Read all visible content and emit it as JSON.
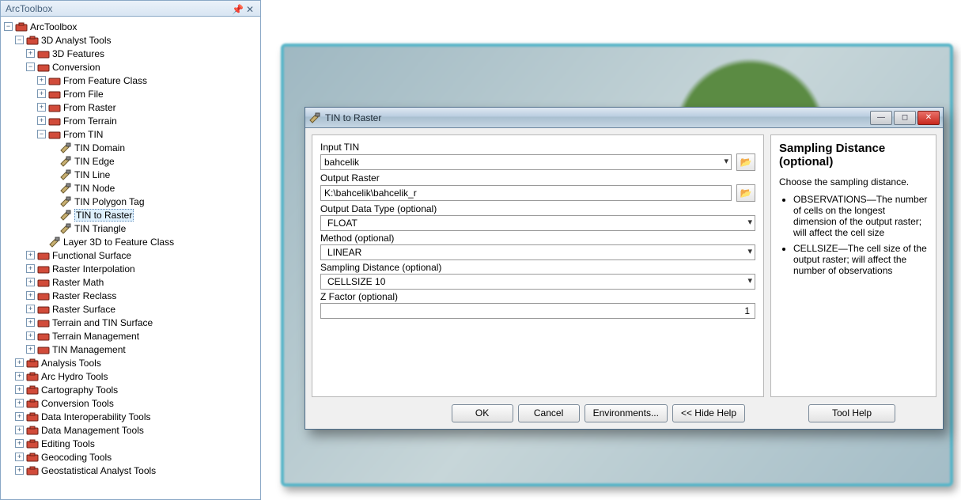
{
  "panel": {
    "title": "ArcToolbox"
  },
  "tree": {
    "root": "ArcToolbox",
    "n3d": "3D Analyst Tools",
    "n3d_feat": "3D Features",
    "conv": "Conversion",
    "ffc": "From Feature Class",
    "ffile": "From File",
    "fraster": "From Raster",
    "fterrain": "From Terrain",
    "ftin": "From TIN",
    "tindomain": "TIN Domain",
    "tinedge": "TIN Edge",
    "tinline": "TIN Line",
    "tinnode": "TIN Node",
    "tinpoly": "TIN Polygon Tag",
    "tinraster": "TIN to Raster",
    "tintri": "TIN Triangle",
    "layer3d": "Layer 3D to Feature Class",
    "funcsurf": "Functional Surface",
    "rinterp": "Raster Interpolation",
    "rmath": "Raster Math",
    "rreclass": "Raster Reclass",
    "rsurface": "Raster Surface",
    "terrtin": "Terrain and TIN Surface",
    "terrmgmt": "Terrain Management",
    "tinmgmt": "TIN Management",
    "analysis": "Analysis Tools",
    "archydro": "Arc Hydro Tools",
    "carto": "Cartography Tools",
    "convtools": "Conversion Tools",
    "datainterop": "Data Interoperability Tools",
    "datamgmt": "Data Management Tools",
    "editing": "Editing Tools",
    "geocoding": "Geocoding Tools",
    "geostat": "Geostatistical Analyst Tools"
  },
  "dialog": {
    "title": "TIN to Raster",
    "labels": {
      "inputTin": "Input TIN",
      "outputRaster": "Output Raster",
      "outputType": "Output Data Type (optional)",
      "method": "Method (optional)",
      "sampling": "Sampling Distance (optional)",
      "zfactor": "Z Factor (optional)"
    },
    "values": {
      "inputTin": "bahcelik",
      "outputRaster": "K:\\bahcelik\\bahcelik_r",
      "outputType": "FLOAT",
      "method": "LINEAR",
      "sampling": "CELLSIZE 10",
      "zfactor": "1"
    },
    "buttons": {
      "ok": "OK",
      "cancel": "Cancel",
      "env": "Environments...",
      "hide": "<< Hide Help",
      "toolhelp": "Tool Help"
    }
  },
  "help": {
    "title": "Sampling Distance (optional)",
    "intro": "Choose the sampling distance.",
    "li1": "OBSERVATIONS—The number of cells on the longest dimension of the output raster; will affect the cell size",
    "li2": "CELLSIZE—The cell size of the output raster; will affect the number of observations"
  }
}
